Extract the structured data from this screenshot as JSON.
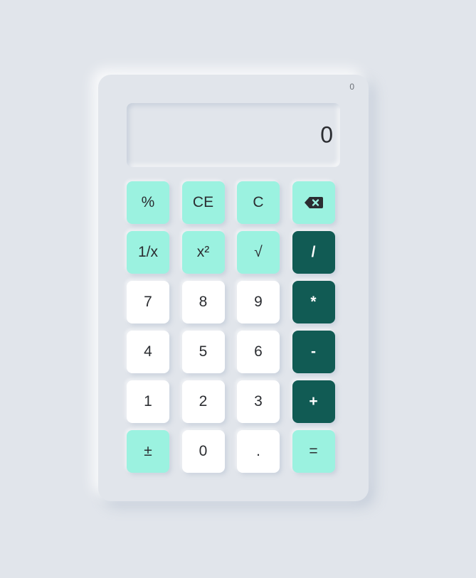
{
  "calculator": {
    "history": "0",
    "display": "0",
    "keys": {
      "percent": "%",
      "clear_entry": "CE",
      "clear": "C",
      "reciprocal": "1/x",
      "square": "x²",
      "sqrt": "√",
      "divide": "/",
      "seven": "7",
      "eight": "8",
      "nine": "9",
      "multiply": "*",
      "four": "4",
      "five": "5",
      "six": "6",
      "subtract": "-",
      "one": "1",
      "two": "2",
      "three": "3",
      "add": "+",
      "negate": "±",
      "zero": "0",
      "decimal": ".",
      "equals": "="
    },
    "icons": {
      "backspace": "backspace-icon"
    },
    "colors": {
      "background": "#e1e5eb",
      "function_key": "#9bf2e0",
      "number_key": "#ffffff",
      "operator_key": "#115b54",
      "text": "#2b2d31"
    }
  }
}
